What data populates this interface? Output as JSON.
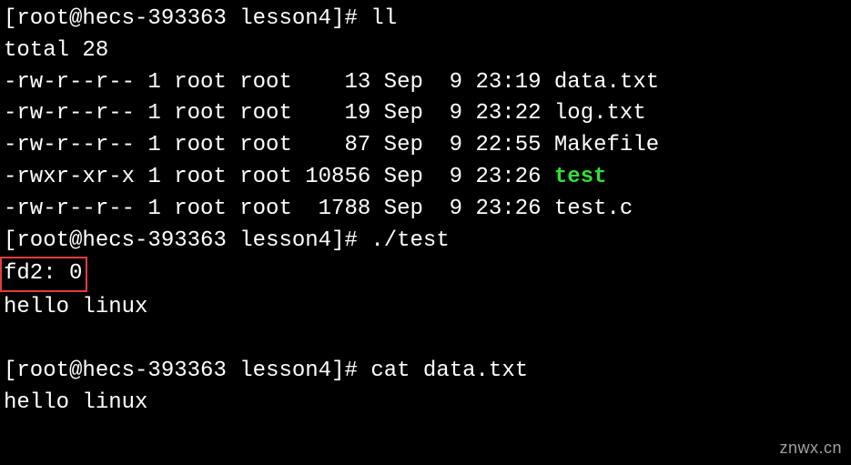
{
  "prompt_user": "root",
  "prompt_host": "hecs-393363",
  "prompt_dir": "lesson4",
  "prompt_symbol": "#",
  "cmd1": "ll",
  "total_line": "total 28",
  "files": [
    {
      "perm": "-rw-r--r--",
      "links": "1",
      "owner": "root",
      "group": "root",
      "size": "   13",
      "month": "Sep",
      "day": " 9",
      "time": "23:19",
      "name": "data.txt",
      "exec": false
    },
    {
      "perm": "-rw-r--r--",
      "links": "1",
      "owner": "root",
      "group": "root",
      "size": "   19",
      "month": "Sep",
      "day": " 9",
      "time": "23:22",
      "name": "log.txt",
      "exec": false
    },
    {
      "perm": "-rw-r--r--",
      "links": "1",
      "owner": "root",
      "group": "root",
      "size": "   87",
      "month": "Sep",
      "day": " 9",
      "time": "22:55",
      "name": "Makefile",
      "exec": false
    },
    {
      "perm": "-rwxr-xr-x",
      "links": "1",
      "owner": "root",
      "group": "root",
      "size": "10856",
      "month": "Sep",
      "day": " 9",
      "time": "23:26",
      "name": "test",
      "exec": true
    },
    {
      "perm": "-rw-r--r--",
      "links": "1",
      "owner": "root",
      "group": "root",
      "size": " 1788",
      "month": "Sep",
      "day": " 9",
      "time": "23:26",
      "name": "test.c",
      "exec": false
    }
  ],
  "cmd2": "./test",
  "fd_output": "fd2: 0",
  "hello1": "hello linux",
  "cmd3": "cat data.txt",
  "hello2": "hello linux",
  "watermark": "znwx.cn"
}
